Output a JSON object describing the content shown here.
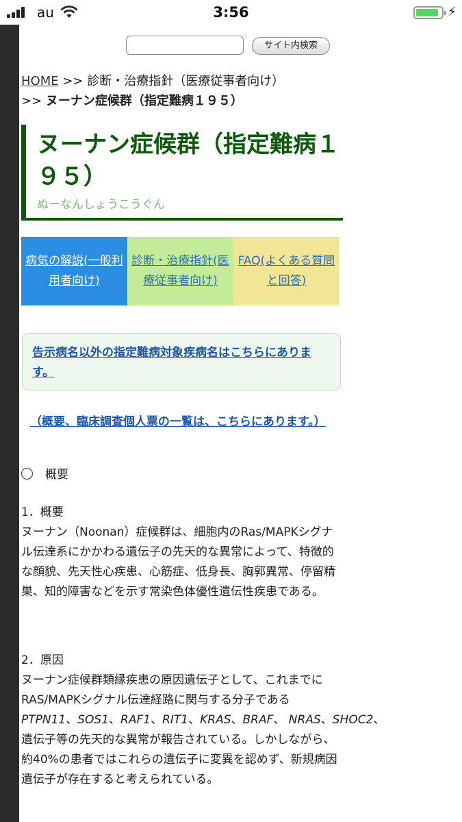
{
  "status_bar": {
    "carrier": "au",
    "time": "3:56",
    "battery_level": 0.9
  },
  "search": {
    "placeholder": "",
    "button_label": "サイト内検索"
  },
  "breadcrumb": {
    "home": "HOME",
    "sep1": ">>",
    "parent": "診断・治療指針（医療従事者向け）",
    "sep2": ">>",
    "current": "ヌーナン症候群（指定難病１９５）"
  },
  "title": {
    "main": "ヌーナン症候群（指定難病１９５）",
    "reading": "ぬーなんしょうこうぐん"
  },
  "tabs": [
    {
      "label": "病気の解説(一般利用者向け)"
    },
    {
      "label": "診断・治療指針(医療従事者向け)"
    },
    {
      "label": "FAQ(よくある質問と回答)"
    }
  ],
  "notice": {
    "link": "告示病名以外の指定難病対象疾病名はこちらにあります。"
  },
  "overview_link": "（概要、臨床調査個人票の一覧は、こちらにあります。）",
  "outline_label": "概要",
  "section1": {
    "heading": "1．概要",
    "text": "ヌーナン（Noonan）症候群は、細胞内のRas/MAPKシグナル伝達系にかかわる遺伝子の先天的な異常によって、特徴的な顔貌、先天性心疾患、心筋症、低身長、胸郭異常、停留精巣、知的障害などを示す常染色体優性遺伝性疾患である。"
  },
  "section2": {
    "heading": "2．原因",
    "intro": "ヌーナン症候群類縁疾患の原因遺伝子として、これまでにRAS/MAPKシグナル伝達経路に関与する分子である",
    "genes": [
      "PTPN11",
      "SOS1",
      "RAF1",
      "RIT1",
      "KRAS",
      "BRAF",
      "NRAS",
      "SHOC2"
    ],
    "text": "遺伝子等の先天的な異常が報告されている。しかしながら、約40%の患者ではこれらの遺伝子に変異を認めず、新規病因遺伝子が存在すると考えられている。"
  }
}
